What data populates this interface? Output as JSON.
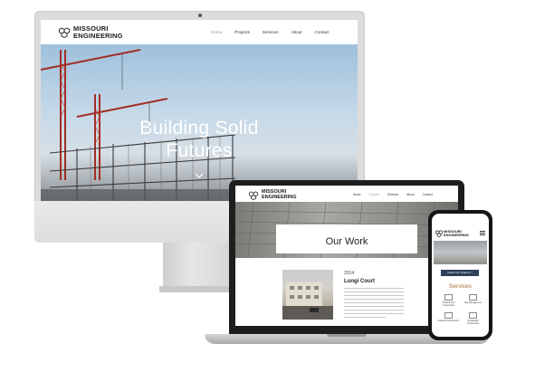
{
  "brand": {
    "line1": "MISSOURI",
    "line2": "ENGINEERING"
  },
  "desktop": {
    "nav": [
      "Home",
      "Projects",
      "Services",
      "About",
      "Contact"
    ],
    "hero_title_line1": "Building Solid",
    "hero_title_line2": "Futures"
  },
  "laptop": {
    "nav": [
      "Home",
      "Projects",
      "Services",
      "About",
      "Contact"
    ],
    "page_title": "Our Work",
    "project": {
      "year": "2014",
      "name": "Lungi Court"
    }
  },
  "phone": {
    "cta_label": "Check Our Projects >",
    "services_heading": "Services",
    "services": [
      "Infrastructure Construction",
      "Site Management",
      "Industrial Construction",
      "Residential Construction"
    ]
  },
  "colors": {
    "accent": "#b06a2c",
    "button": "#2d3f5a",
    "device_frame": "#1e1e1e",
    "monitor": "#dcdcdc"
  }
}
